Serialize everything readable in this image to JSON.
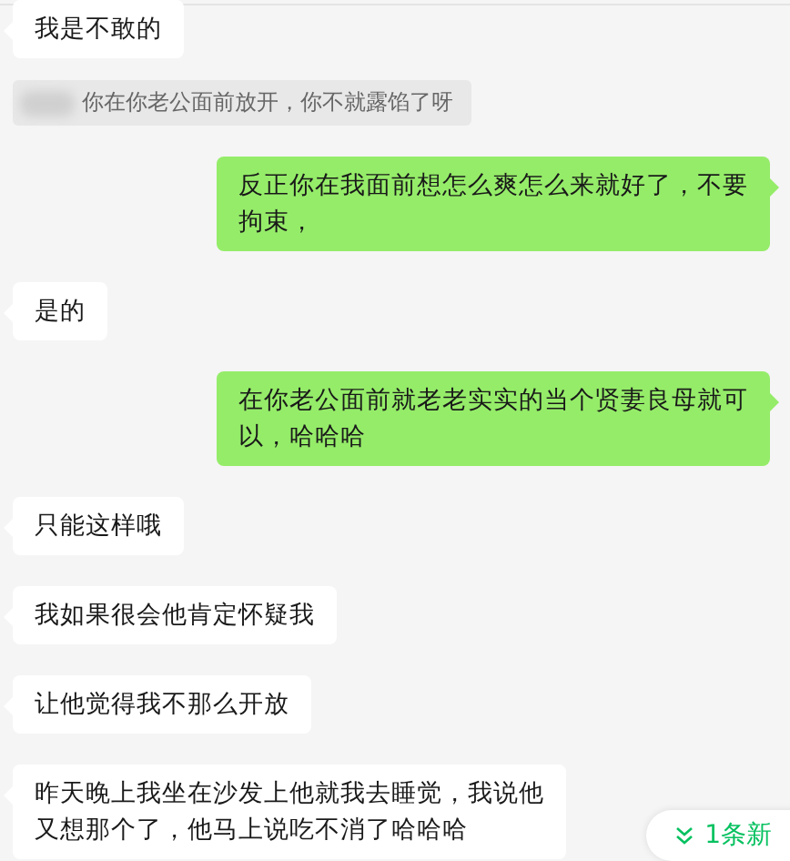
{
  "messages": [
    {
      "kind": "received",
      "text": "我是不敢的"
    },
    {
      "kind": "quote",
      "text": "你在你老公面前放开，你不就露馅了呀"
    },
    {
      "kind": "sent",
      "text": "反正你在我面前想怎么爽怎么来就好了，不要拘束，"
    },
    {
      "kind": "received",
      "text": "是的"
    },
    {
      "kind": "sent",
      "text": "在你老公面前就老老实实的当个贤妻良母就可以，哈哈哈"
    },
    {
      "kind": "received",
      "text": "只能这样哦"
    },
    {
      "kind": "received",
      "text": "我如果很会他肯定怀疑我"
    },
    {
      "kind": "received",
      "text": "让他觉得我不那么开放"
    },
    {
      "kind": "received",
      "text": "昨天晚上我坐在沙发上他就我去睡觉，我说他又想那个了，他马上说吃不消了哈哈哈"
    }
  ],
  "new_messages": {
    "label": "1条新"
  }
}
